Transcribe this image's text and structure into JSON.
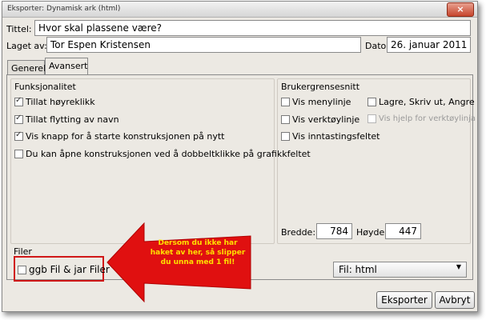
{
  "window": {
    "title": "Eksporter: Dynamisk ark (html)",
    "close_glyph": "×"
  },
  "form": {
    "title_label": "Tittel:",
    "title_value": "Hvor skal plassene være?",
    "author_label": "Laget av:",
    "author_value": "Tor Espen Kristensen",
    "date_label": "Dato:",
    "date_value": "26. januar 2011"
  },
  "tabs": [
    {
      "label": "Generelt"
    },
    {
      "label": "Avansert"
    }
  ],
  "functionality": {
    "heading": "Funksjonalitet",
    "items": [
      {
        "label": "Tillat høyreklikk",
        "checked": true
      },
      {
        "label": "Tillat flytting av navn",
        "checked": true
      },
      {
        "label": "Vis knapp for å starte konstruksjonen på nytt",
        "checked": true
      },
      {
        "label": "Du kan åpne konstruksjonen ved å dobbeltklikke på grafikkfeltet",
        "checked": false
      }
    ]
  },
  "ui": {
    "heading": "Brukergrensesnitt",
    "items": [
      {
        "label": "Vis menylinje",
        "checked": false
      },
      {
        "label": "Vis verktøylinje",
        "checked": false
      },
      {
        "label": "Vis inntastingsfeltet",
        "checked": false
      },
      {
        "label": "Lagre, Skriv ut, Angre",
        "checked": false
      },
      {
        "label": "Vis hjelp for verktøylinja",
        "checked": false,
        "disabled": true
      }
    ],
    "width_label": "Bredde:",
    "width_value": "784",
    "height_label": "Høyde:",
    "height_value": "447"
  },
  "files": {
    "heading": "Filer",
    "checkbox_label": "ggb Fil & jar Filer",
    "checked": false,
    "select_value": "Fil: html"
  },
  "annotation": {
    "text": "Dersom du ikke har haket av her, så slipper du unna med 1 fil!",
    "arrow_color": "#e01010",
    "text_color": "#ffe000"
  },
  "buttons": {
    "export": "Eksporter",
    "cancel": "Avbryt"
  }
}
